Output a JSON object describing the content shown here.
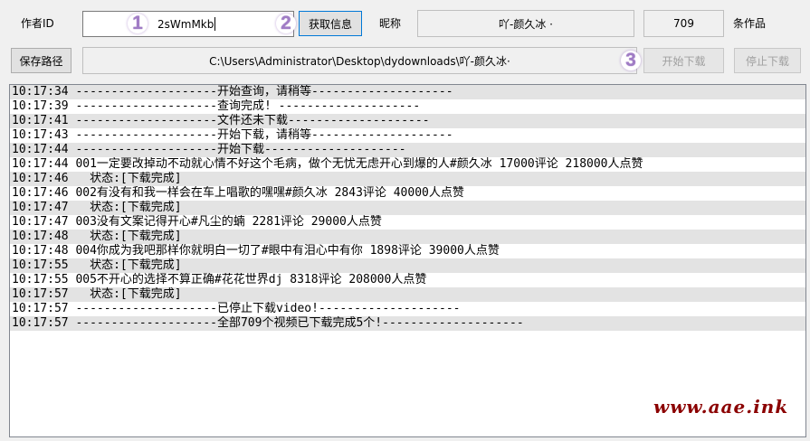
{
  "row1": {
    "author_id_label": "作者ID",
    "author_id_value": "2sWmMkb",
    "fetch_button": "获取信息",
    "nickname_label": "昵称",
    "nickname_value": "吖-颜久冰 ·",
    "works_count": "709",
    "works_label": "条作品"
  },
  "row2": {
    "save_path_button": "保存路径",
    "save_path_value": "C:\\Users\\Administrator\\Desktop\\dydownloads\\吖-颜久冰·",
    "start_button": "开始下载",
    "stop_button": "停止下载"
  },
  "badges": [
    "1",
    "2",
    "3"
  ],
  "log": [
    {
      "time": "10:17:34",
      "text": " --------------------开始查询，请稍等--------------------"
    },
    {
      "time": "10:17:39",
      "text": " --------------------查询完成! --------------------"
    },
    {
      "time": "10:17:41",
      "text": " --------------------文件还未下载--------------------"
    },
    {
      "time": "10:17:43",
      "text": " --------------------开始下载，请稍等--------------------"
    },
    {
      "time": "10:17:44",
      "text": " --------------------开始下载--------------------"
    },
    {
      "time": "10:17:44",
      "text": " 001一定要改掉动不动就心情不好这个毛病，做个无忧无虑开心到爆的人#颜久冰 17000评论 218000人点赞"
    },
    {
      "time": "10:17:46",
      "text": "   状态:[下载完成]"
    },
    {
      "time": "10:17:46",
      "text": " 002有没有和我一样会在车上唱歌的嘿嘿#颜久冰 2843评论 40000人点赞"
    },
    {
      "time": "10:17:47",
      "text": "   状态:[下载完成]"
    },
    {
      "time": "10:17:47",
      "text": " 003没有文案记得开心#凡尘的蝻 2281评论 29000人点赞"
    },
    {
      "time": "10:17:48",
      "text": "   状态:[下载完成]"
    },
    {
      "time": "10:17:48",
      "text": " 004你成为我吧那样你就明白一切了#眼中有泪心中有你 1898评论 39000人点赞"
    },
    {
      "time": "10:17:55",
      "text": "   状态:[下载完成]"
    },
    {
      "time": "10:17:55",
      "text": " 005不开心的选择不算正确#花花世界dj 8318评论 208000人点赞"
    },
    {
      "time": "10:17:57",
      "text": "   状态:[下载完成]"
    },
    {
      "time": "10:17:57",
      "text": " --------------------已停止下载video!--------------------"
    },
    {
      "time": "10:17:57",
      "text": " --------------------全部709个视频已下载完成5个!--------------------"
    }
  ],
  "watermark": "www.aae.ink",
  "colors": {
    "badge": "#a07cc5",
    "row_shade": "#e3e3e3",
    "watermark": "#8b0000"
  }
}
